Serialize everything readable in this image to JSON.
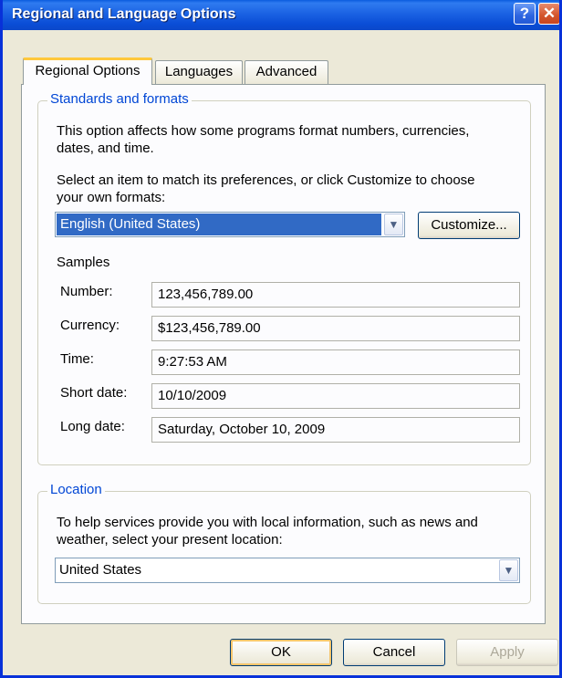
{
  "window": {
    "title": "Regional and Language Options",
    "help_glyph": "?",
    "close_glyph": "✕"
  },
  "tabs": [
    {
      "label": "Regional Options",
      "active": true
    },
    {
      "label": "Languages",
      "active": false
    },
    {
      "label": "Advanced",
      "active": false
    }
  ],
  "standards": {
    "legend": "Standards and formats",
    "desc_line1": "This option affects how some programs format numbers, currencies,",
    "desc_line2": "dates, and time.",
    "select_line1": "Select an item to match its preferences, or click Customize to choose",
    "select_line2": "your own formats:",
    "format_value": "English (United States)",
    "customize_label": "Customize...",
    "samples_heading": "Samples",
    "samples": [
      {
        "label": "Number:",
        "value": "123,456,789.00"
      },
      {
        "label": "Currency:",
        "value": "$123,456,789.00"
      },
      {
        "label": "Time:",
        "value": "9:27:53 AM"
      },
      {
        "label": "Short date:",
        "value": "10/10/2009"
      },
      {
        "label": "Long date:",
        "value": "Saturday, October 10, 2009"
      }
    ]
  },
  "location": {
    "legend": "Location",
    "desc_line1": "To help services provide you with local information, such as news and",
    "desc_line2": "weather, select your present location:",
    "value": "United States"
  },
  "buttons": {
    "ok": "OK",
    "cancel": "Cancel",
    "apply": "Apply"
  },
  "icons": {
    "dropdown": "chevron-down-icon"
  },
  "colors": {
    "titlebar": "#0a4dd6",
    "group_legend": "#0046d5",
    "selection": "#316ac5",
    "active_tab_accent": "#ffc83c"
  }
}
